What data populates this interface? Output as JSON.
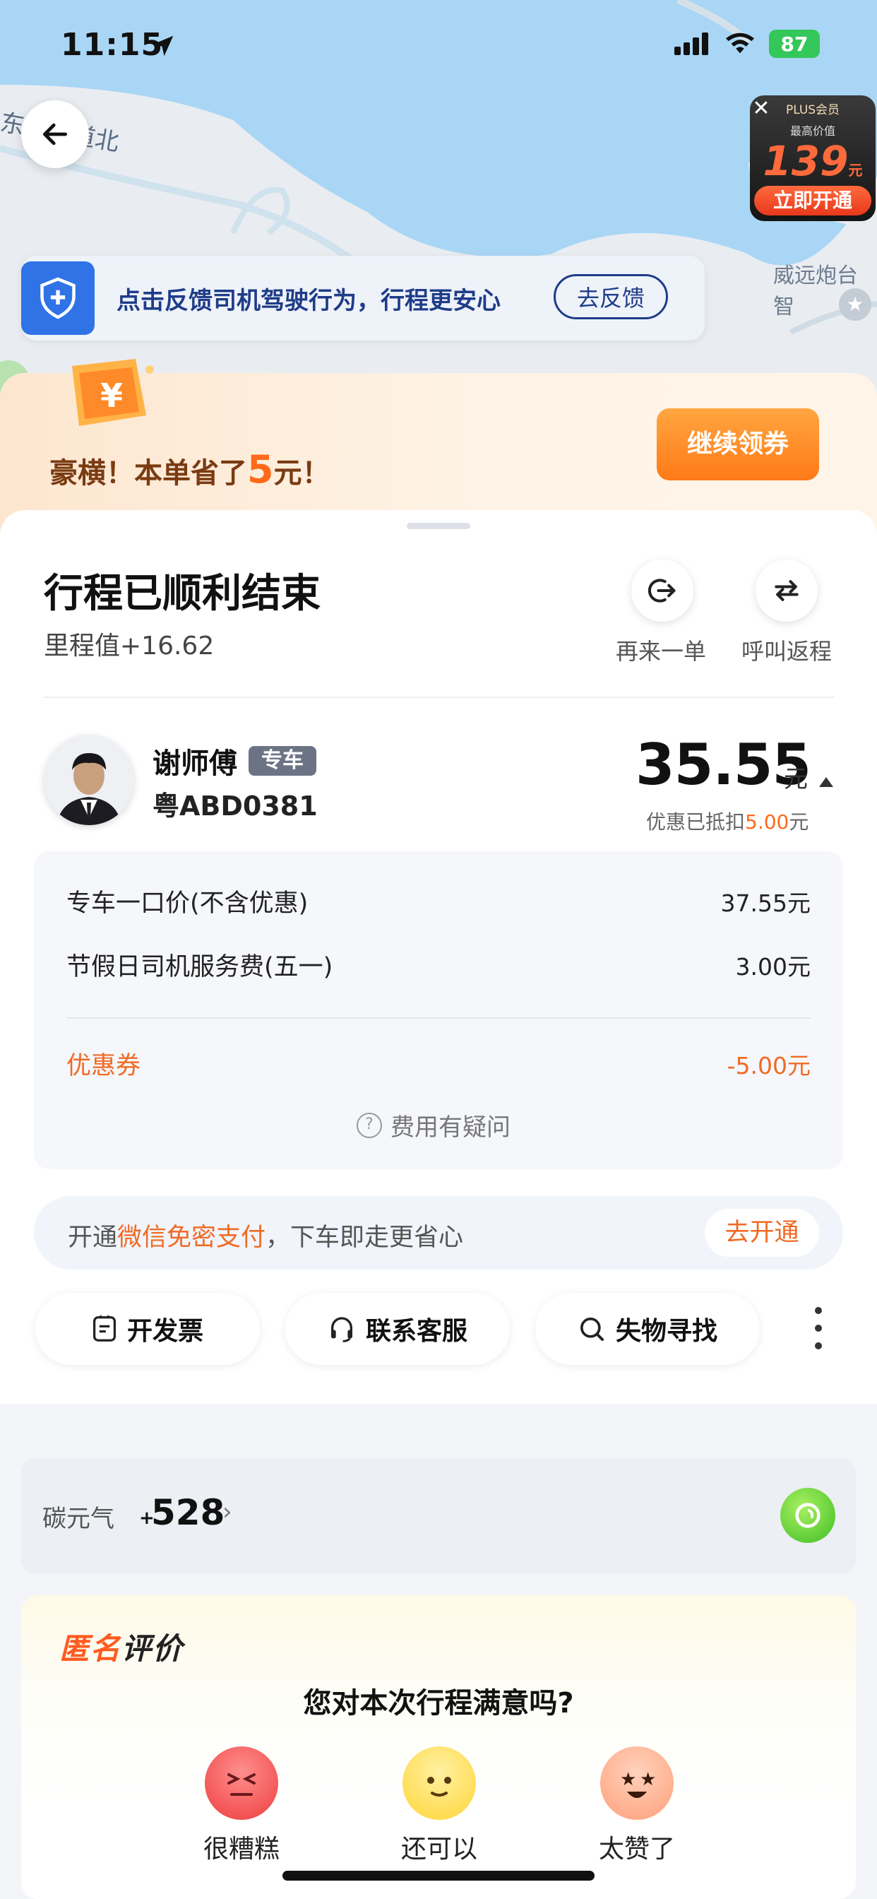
{
  "status_bar": {
    "time": "11:15",
    "battery": "87"
  },
  "map": {
    "label_bottom_right": "威远炮台智",
    "label_top_left": "东市大道北"
  },
  "plus_ad": {
    "title": "PLUS会员",
    "subtitle": "最高价值",
    "amount": "139",
    "unit": "元",
    "button": "立即开通"
  },
  "feedback_banner": {
    "text": "点击反馈司机驾驶行为，行程更安心",
    "button": "去反馈"
  },
  "promo": {
    "prefix": "豪横！本单省了",
    "amount": "5",
    "suffix": "元！",
    "button": "继续领券"
  },
  "trip": {
    "title": "行程已顺利结束",
    "mileage": "里程值+16.62",
    "actions": [
      {
        "label": "再来一单"
      },
      {
        "label": "呼叫返程"
      }
    ]
  },
  "driver": {
    "name": "谢师傅",
    "car_type": "专车",
    "plate": "粤ABD0381"
  },
  "fare": {
    "total": "35.55",
    "unit": "元",
    "discount_prefix": "优惠已抵扣",
    "discount_amount": "5.00",
    "discount_unit": "元",
    "items": [
      {
        "label": "专车一口价(不含优惠)",
        "value": "37.55元"
      },
      {
        "label": "节假日司机服务费(五一)",
        "value": "3.00元"
      }
    ],
    "coupon": {
      "label": "优惠券",
      "value": "-5.00元"
    },
    "question": "费用有疑问"
  },
  "pay_bar": {
    "prefix": "开通",
    "highlight": "微信免密支付",
    "suffix": "，下车即走更省心",
    "button": "去开通"
  },
  "quick_actions": [
    {
      "label": "开发票"
    },
    {
      "label": "联系客服"
    },
    {
      "label": "失物寻找"
    }
  ],
  "carbon": {
    "label": "碳元气",
    "plus": "+",
    "value": "528"
  },
  "rating": {
    "badge_a": "匿名",
    "badge_b": "评价",
    "question": "您对本次行程满意吗?",
    "options": [
      {
        "label": "很糟糕"
      },
      {
        "label": "还可以"
      },
      {
        "label": "太赞了"
      }
    ]
  },
  "colors": {
    "accent": "#f06a24",
    "brand_blue": "#2f73e6",
    "map_water": "#a9d6f5"
  }
}
